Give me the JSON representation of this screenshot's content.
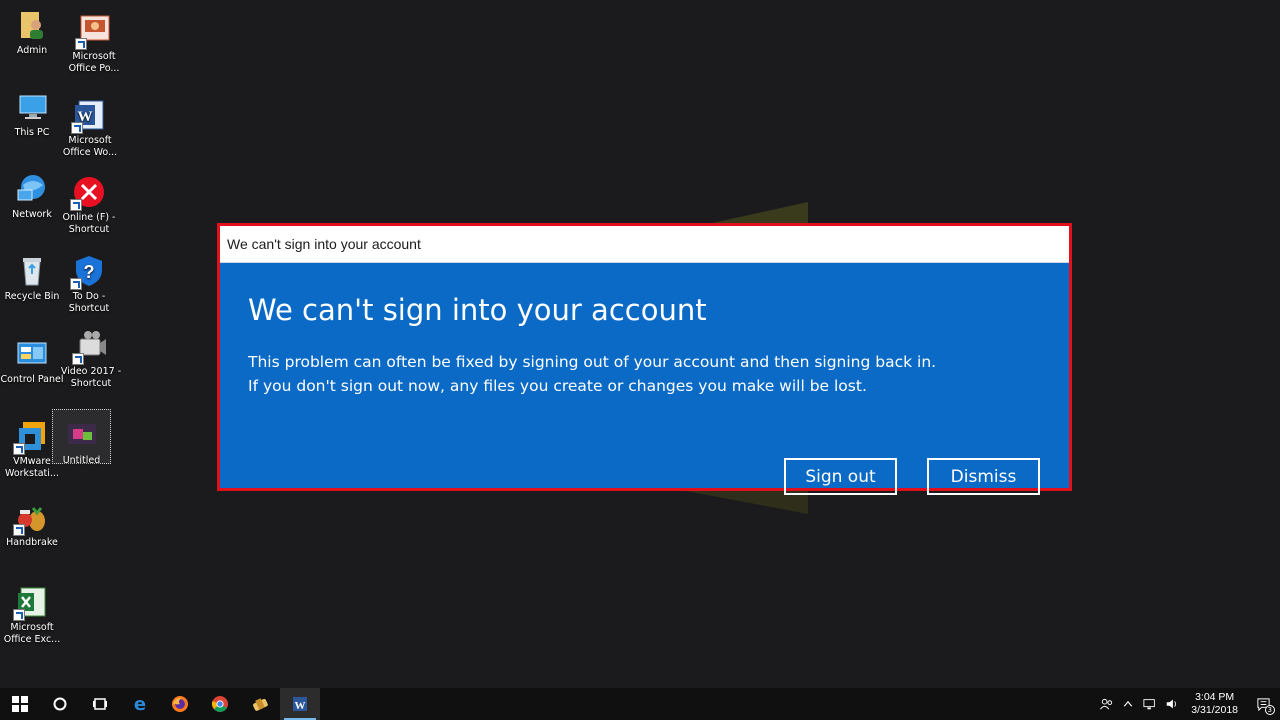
{
  "desktop": {
    "icons": [
      {
        "label": "Admin"
      },
      {
        "label": "Microsoft Office Po..."
      },
      {
        "label": "This PC"
      },
      {
        "label": "Microsoft Office Wo..."
      },
      {
        "label": "Network"
      },
      {
        "label": "Online (F) - Shortcut"
      },
      {
        "label": "Recycle Bin"
      },
      {
        "label": "To Do - Shortcut"
      },
      {
        "label": "Control Panel"
      },
      {
        "label": "Video 2017 - Shortcut"
      },
      {
        "label": "VMware Workstati..."
      },
      {
        "label": "Untitled"
      },
      {
        "label": "Handbrake"
      },
      {
        "label": "Microsoft Office Exc..."
      }
    ]
  },
  "dialog": {
    "window_title": "We can't sign into your account",
    "heading": "We can't sign into your account",
    "line1": "This problem can often be fixed by signing out of your account and then signing back in.",
    "line2": "If you don't sign out now, any files you create or changes you make will be lost.",
    "sign_out_label": "Sign out",
    "dismiss_label": "Dismiss",
    "accent_color": "#0067c0",
    "highlight_color": "#e0101c"
  },
  "taskbar": {
    "items": [
      "windows-start-icon",
      "cortana-icon",
      "task-view-icon",
      "edge-icon",
      "firefox-icon",
      "chrome-icon",
      "app-icon",
      "word-icon"
    ],
    "time": "3:04 PM",
    "date": "3/31/2018",
    "notification_count": "3"
  }
}
